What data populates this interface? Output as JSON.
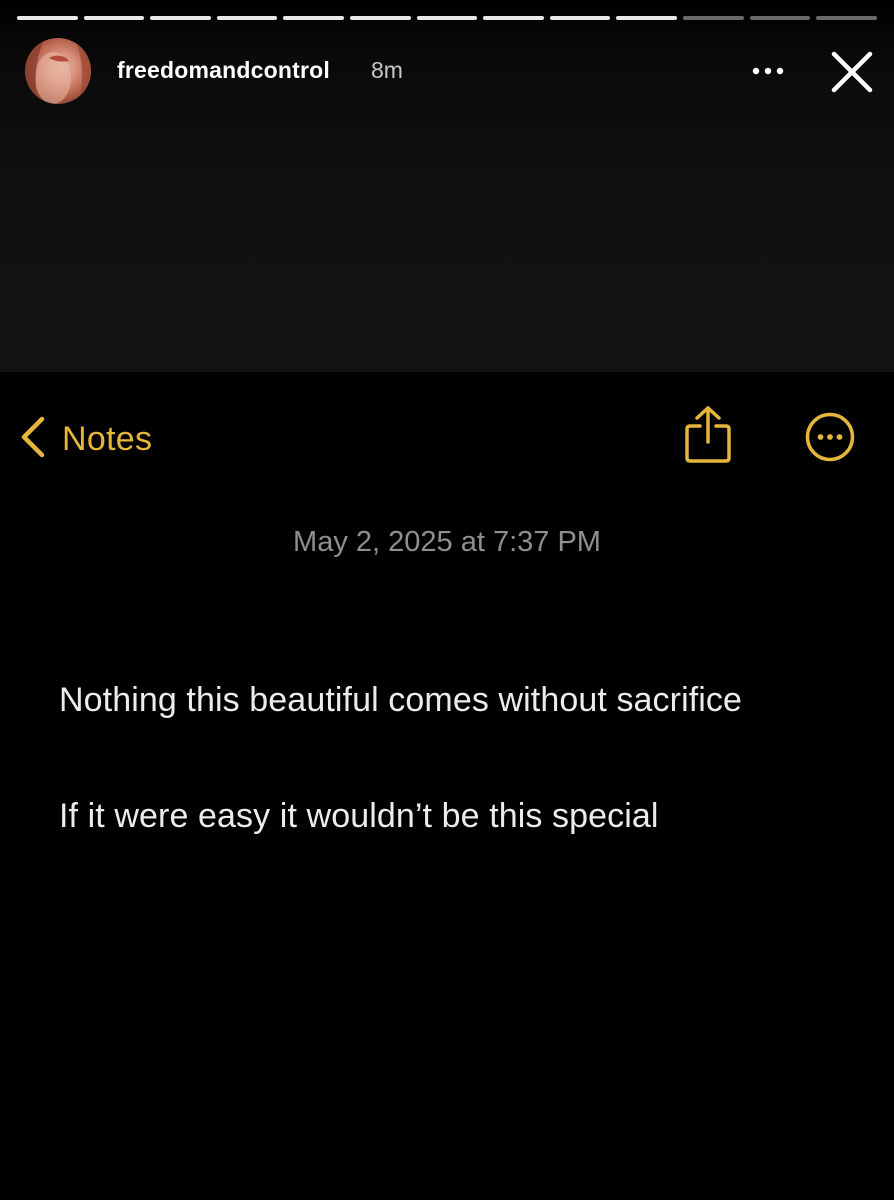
{
  "story": {
    "progress": {
      "total_segments": 13,
      "viewed_segments": 10
    },
    "username": "freedomandcontrol",
    "time_ago": "8m",
    "icons": {
      "more": "more-horizontal-icon",
      "close": "close-icon"
    }
  },
  "note": {
    "back_label": "Notes",
    "accent_color": "#E5B63B",
    "date": "May 2, 2025 at 7:37 PM",
    "lines": [
      "Nothing this beautiful comes without sacrifice",
      "If it were easy it wouldn’t be this special"
    ],
    "icons": {
      "back": "chevron-left-icon",
      "share": "share-icon",
      "more": "more-circle-icon"
    }
  }
}
